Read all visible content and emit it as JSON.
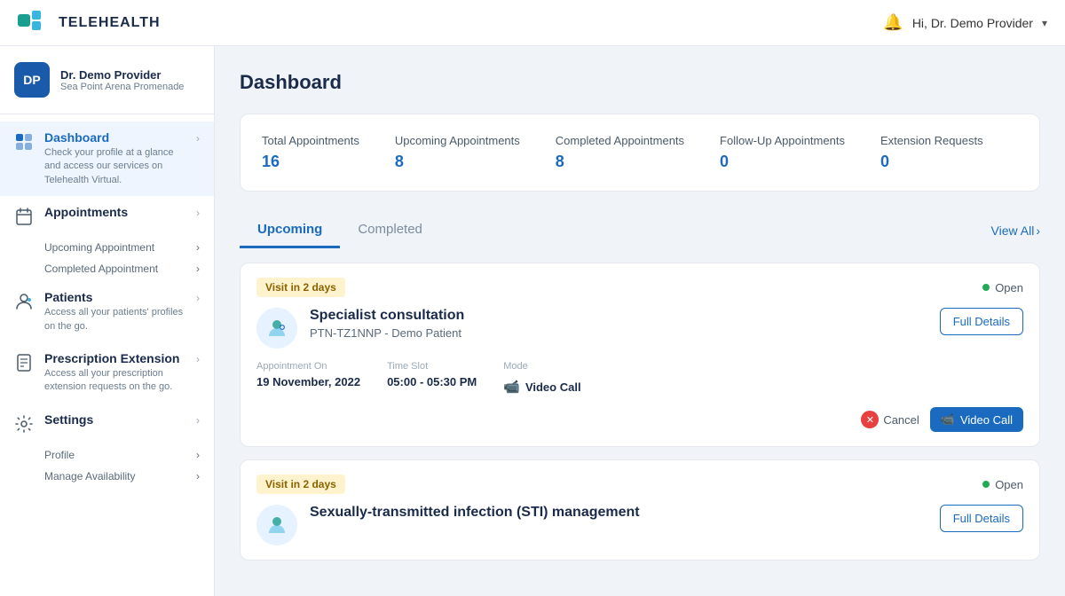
{
  "header": {
    "logo_text": "TELEHEALTH",
    "user_greeting": "Hi, Dr. Demo Provider"
  },
  "sidebar": {
    "provider": {
      "initials": "DP",
      "name": "Dr. Demo Provider",
      "location": "Sea Point Arena Promenade"
    },
    "nav_items": [
      {
        "id": "dashboard",
        "label": "Dashboard",
        "desc": "Check your profile at a glance and access our services on Telehealth Virtual.",
        "active": true
      },
      {
        "id": "appointments",
        "label": "Appointments",
        "sub": [
          "Upcoming Appointment",
          "Completed Appointment"
        ]
      },
      {
        "id": "patients",
        "label": "Patients",
        "desc": "Access all your patients' profiles on the go."
      },
      {
        "id": "prescription-extension",
        "label": "Prescription Extension",
        "desc": "Access all your prescription extension requests on the go."
      },
      {
        "id": "settings",
        "label": "Settings",
        "sub": [
          "Profile",
          "Manage Availability"
        ]
      }
    ]
  },
  "page_title": "Dashboard",
  "stats": [
    {
      "label": "Total Appointments",
      "value": "16"
    },
    {
      "label": "Upcoming Appointments",
      "value": "8"
    },
    {
      "label": "Completed Appointments",
      "value": "8"
    },
    {
      "label": "Follow-Up Appointments",
      "value": "0"
    },
    {
      "label": "Extension Requests",
      "value": "0"
    }
  ],
  "tabs": {
    "active": "Upcoming",
    "items": [
      "Upcoming",
      "Completed"
    ],
    "view_all": "View All"
  },
  "appointments": [
    {
      "badge": "Visit in 2 days",
      "status": "Open",
      "title": "Specialist consultation",
      "patient": "PTN-TZ1NNP - Demo Patient",
      "appointment_on_label": "Appointment On",
      "appointment_on_value": "19 November, 2022",
      "time_slot_label": "Time Slot",
      "time_slot_value": "05:00 - 05:30 PM",
      "mode_label": "Mode",
      "mode_value": "Video Call",
      "btn_full_details": "Full Details",
      "btn_cancel": "Cancel",
      "btn_video_call": "Video Call"
    },
    {
      "badge": "Visit in 2 days",
      "status": "Open",
      "title": "Sexually-transmitted infection (STI) management",
      "patient": "",
      "btn_full_details": "Full Details"
    }
  ]
}
